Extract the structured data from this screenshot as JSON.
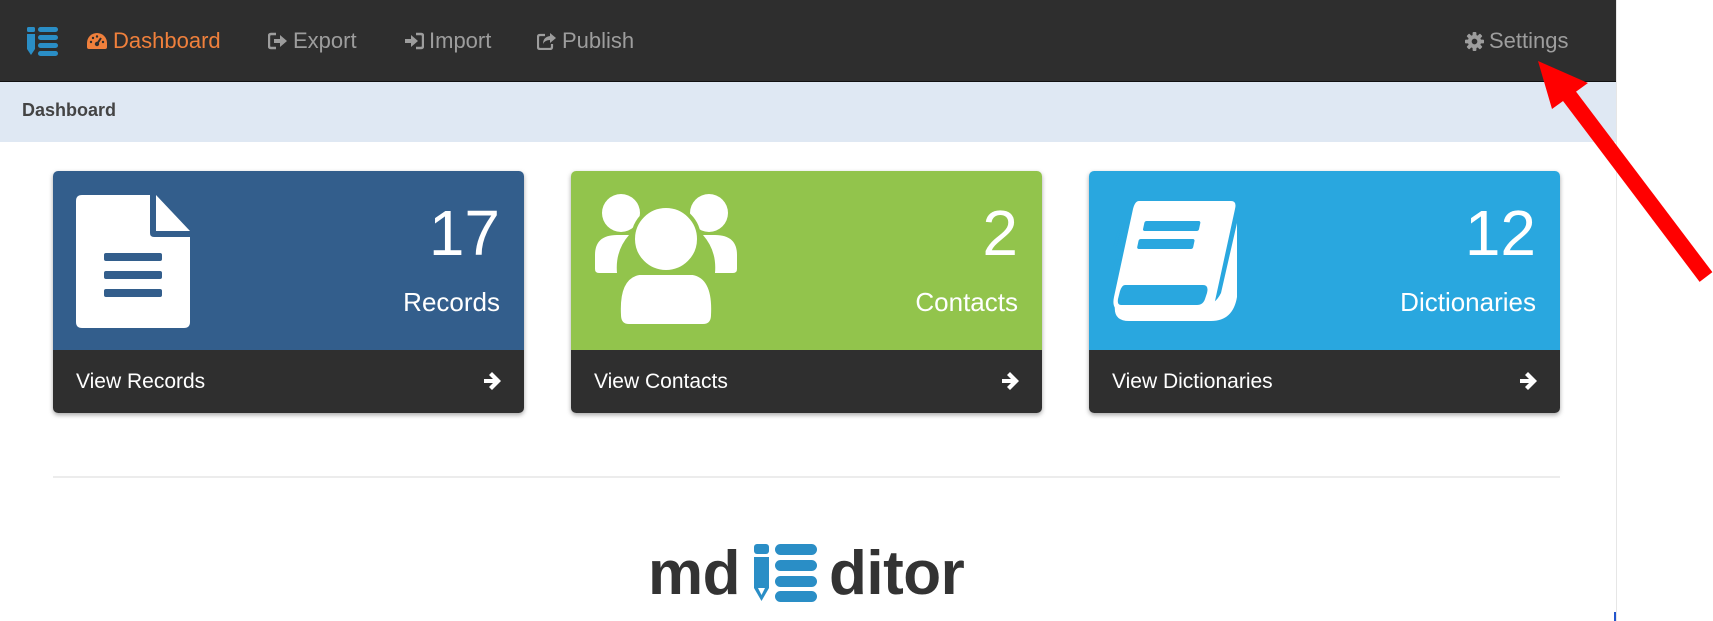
{
  "navbar": {
    "brand_icon": "mdeditor-logo-icon",
    "items": [
      {
        "label": "Dashboard",
        "icon": "dashboard-gauge-icon",
        "active": true
      },
      {
        "label": "Export",
        "icon": "export-icon",
        "active": false
      },
      {
        "label": "Import",
        "icon": "import-icon",
        "active": false
      },
      {
        "label": "Publish",
        "icon": "publish-icon",
        "active": false
      }
    ],
    "settings": {
      "label": "Settings",
      "icon": "gear-icon"
    }
  },
  "breadcrumb": {
    "current": "Dashboard"
  },
  "cards": [
    {
      "count": "17",
      "label": "Records",
      "footer": "View Records",
      "color": "#335e8c",
      "icon": "file-text-icon"
    },
    {
      "count": "2",
      "label": "Contacts",
      "footer": "View Contacts",
      "color": "#92c44c",
      "icon": "users-icon"
    },
    {
      "count": "12",
      "label": "Dictionaries",
      "footer": "View Dictionaries",
      "color": "#29a7df",
      "icon": "book-icon"
    }
  ],
  "logo": {
    "prefix": "md",
    "suffix": "ditor",
    "icon": "mdeditor-logo-icon"
  },
  "colors": {
    "navbar_bg": "#2e2e2e",
    "nav_text": "#9d9d9d",
    "nav_active": "#f0803c",
    "breadcrumb_bg": "#dfe8f3",
    "footer_bg": "#2f2f2f",
    "annotation_arrow": "#ff0000",
    "logo_blue": "#2a8ec6"
  }
}
